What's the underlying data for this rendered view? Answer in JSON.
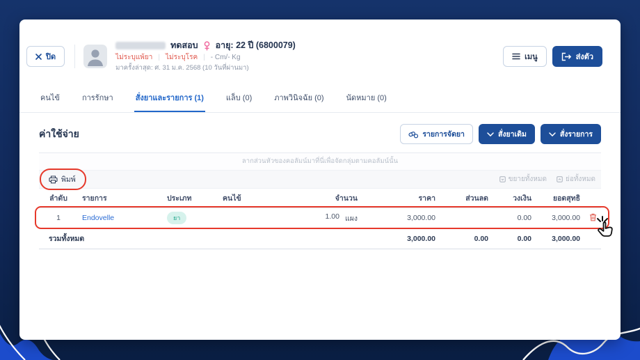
{
  "colors": {
    "accent": "#1d4e99",
    "active_tab": "#2166c9",
    "annotation_red": "#e6392b",
    "alert_text": "#e0584d",
    "badge_bg": "#d6f2ec",
    "badge_text": "#27a98f",
    "wave_blue": "#1c4ccc"
  },
  "header": {
    "close_label": "ปิด",
    "menu_label": "เมนู",
    "transfer_label": "ส่งตัว",
    "patient": {
      "name": "ทดสอบ",
      "age_id": "อายุ: 22 ปี (6800079)",
      "allergy": "ไม่ระบุแพ้ยา",
      "disease": "ไม่ระบุโรค",
      "metrics": "- Cm/- Kg",
      "last_visit": "มาครั้งล่าสุด: ศ. 31 ม.ค. 2568 (10 วันที่ผ่านมา)"
    }
  },
  "tabs": [
    {
      "label": "คนไข้"
    },
    {
      "label": "การรักษา"
    },
    {
      "label": "สั่งยาและรายการ (1)"
    },
    {
      "label": "แล็บ (0)"
    },
    {
      "label": "ภาพวินิจฉัย (0)"
    },
    {
      "label": "นัดหมาย (0)"
    }
  ],
  "billing": {
    "title": "ค่าใช้จ่าย",
    "dispense_button": "รายการจัดยา",
    "previous_order_button": "สั่งยาเดิม",
    "new_order_button": "สั่งรายการ",
    "group_hint": "ลากส่วนหัวของคอลัมน์มาที่นี่เพื่อจัดกลุ่มตามคอลัมน์นั้น",
    "print_label": "พิมพ์",
    "expand_all": "ขยายทั้งหมด",
    "collapse_all": "ย่อทั้งหมด",
    "table": {
      "columns": [
        "ลำดับ",
        "รายการ",
        "ประเภท",
        "คนไข้",
        "จำนวน",
        "ราคา",
        "ส่วนลด",
        "วงเงิน",
        "ยอดสุทธิ"
      ],
      "rows": [
        {
          "seq": "1",
          "item": "Endovelle",
          "type": "ยา",
          "patient": "",
          "qty": "1.00",
          "unit": "แผง",
          "price": "3,000.00",
          "discount": "",
          "credit": "0.00",
          "net": "3,000.00"
        }
      ],
      "footer": {
        "label": "รวมทั้งหมด",
        "price": "3,000.00",
        "discount": "0.00",
        "credit": "0.00",
        "net": "3,000.00"
      }
    }
  }
}
